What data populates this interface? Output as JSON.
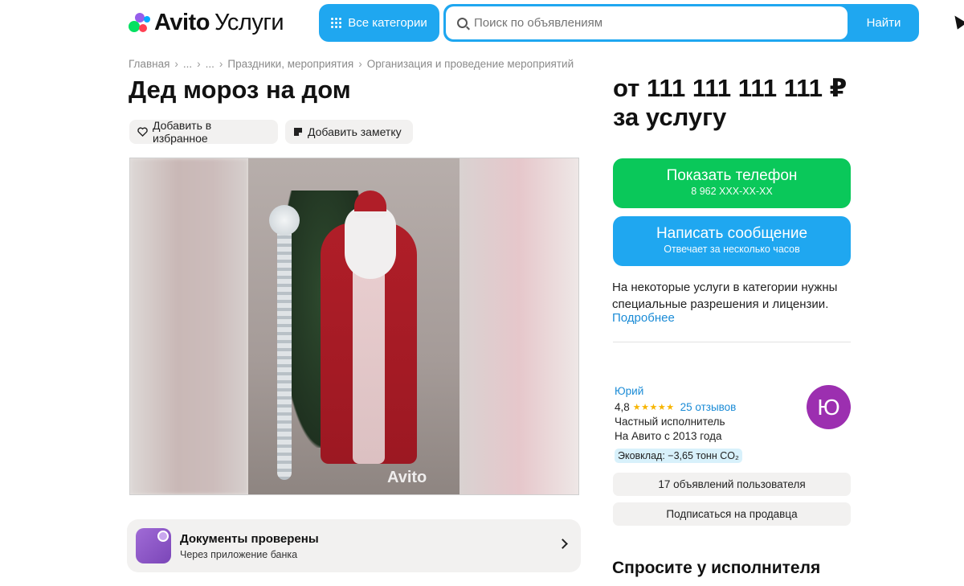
{
  "header": {
    "logo_brand": "Avito",
    "logo_service": "Услуги",
    "categories_button": "Все категории",
    "search_placeholder": "Поиск по объявлениям",
    "search_button": "Найти"
  },
  "breadcrumb": [
    "Главная",
    "...",
    "...",
    "Праздники, мероприятия",
    "Организация и проведение мероприятий"
  ],
  "listing": {
    "title": "Дед мороз на дом",
    "favorite_label": "Добавить в избранное",
    "note_label": "Добавить заметку",
    "photo_watermark": "Avito"
  },
  "verification": {
    "title": "Документы проверены",
    "subtitle": "Через приложение банка"
  },
  "price": {
    "line1": "от 111 111 111 111 ₽",
    "line2": "за услугу"
  },
  "actions": {
    "phone_label": "Показать телефон",
    "phone_number": "8 962 XXX-XX-XX",
    "message_label": "Написать сообщение",
    "message_sub": "Отвечает за несколько часов"
  },
  "notice": {
    "text": "На некоторые услуги в категории нужны специальные разрешения и лицензии.",
    "link": "Подробнее"
  },
  "seller": {
    "name": "Юрий",
    "rating": "4,8",
    "stars": "★★★★★",
    "reviews": "25 отзывов",
    "type": "Частный исполнитель",
    "since": "На Авито с 2013 года",
    "eco": "Эковклад: −3,65 тонн CO₂",
    "avatar_letter": "Ю",
    "listings_button": "17 объявлений пользователя",
    "subscribe_button": "Подписаться на продавца"
  },
  "ask_title": "Спросите у исполнителя",
  "colors": {
    "brand_blue": "#1fa7f0",
    "call_green": "#0ac85a",
    "avatar_purple": "#9c2fb0",
    "link_blue": "#1a8bd6"
  }
}
